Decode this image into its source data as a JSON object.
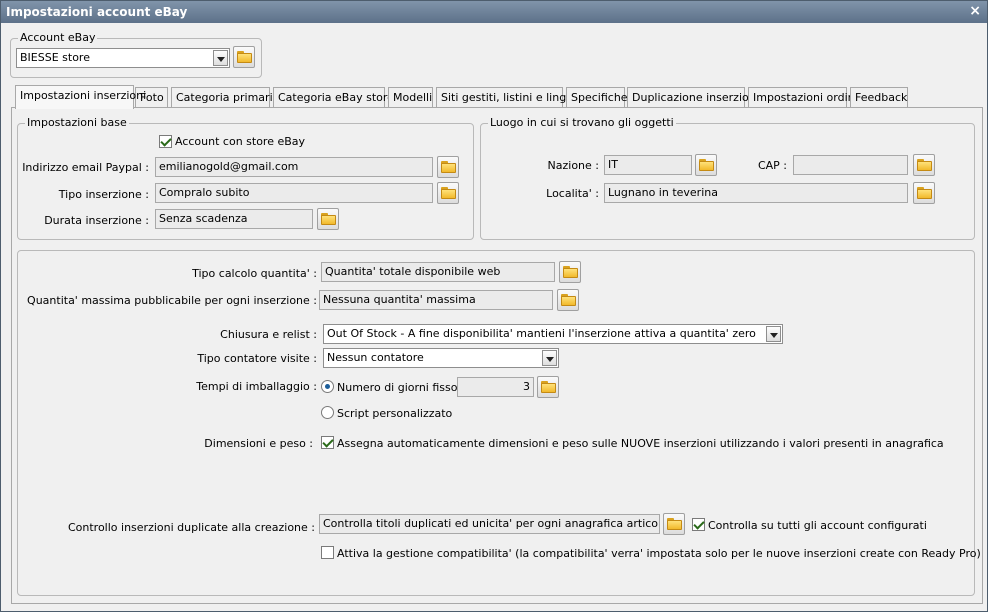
{
  "window": {
    "title": "Impostazioni account eBay",
    "close_label": "×"
  },
  "account": {
    "legend": "Account eBay",
    "selected": "BIESSE store"
  },
  "tabs": [
    "Impostazioni inserzioni",
    "Foto",
    "Categoria primaria",
    "Categoria eBay store",
    "Modelli",
    "Siti gestiti, listini e lingue",
    "Specifiche",
    "Duplicazione inserzioni",
    "Impostazioni ordini",
    "Feedback"
  ],
  "base": {
    "legend": "Impostazioni base",
    "store_checkbox": "Account con store eBay",
    "email_label": "Indirizzo email Paypal :",
    "email_value": "emilianogold@gmail.com",
    "tipo_label": "Tipo inserzione :",
    "tipo_value": "Compralo subito",
    "durata_label": "Durata inserzione :",
    "durata_value": "Senza scadenza"
  },
  "location": {
    "legend": "Luogo in cui si trovano gli oggetti",
    "nazione_label": "Nazione :",
    "nazione_value": "IT",
    "cap_label": "CAP :",
    "cap_value": "",
    "localita_label": "Localita' :",
    "localita_value": "Lugnano in teverina"
  },
  "settings": {
    "calcolo_label": "Tipo calcolo quantita' :",
    "calcolo_value": "Quantita' totale disponibile web",
    "massima_label": "Quantita' massima pubblicabile per ogni inserzione :",
    "massima_value": "Nessuna quantita' massima",
    "chiusura_label": "Chiusura e relist :",
    "chiusura_value": "Out Of Stock - A fine disponibilita' mantieni l'inserzione attiva a quantita' zero",
    "contatore_label": "Tipo contatore visite :",
    "contatore_value": "Nessun contatore",
    "imballaggio_label": "Tempi di imballaggio :",
    "radio_fisso": "Numero di giorni fisso",
    "giorni_value": "3",
    "radio_script": "Script personalizzato",
    "dimensioni_label": "Dimensioni e peso :",
    "dimensioni_check": "Assegna automaticamente dimensioni e peso sulle NUOVE inserzioni utilizzando i valori presenti in anagrafica",
    "duplicate_label": "Controllo inserzioni duplicate alla creazione :",
    "duplicate_value": "Controlla titoli duplicati ed unicita' per ogni anagrafica articolo",
    "controlla_tutti": "Controlla su tutti gli account configurati",
    "compat_check": "Attiva la gestione compatibilita'  (la compatibilita' verra' impostata solo per le nuove inserzioni create con Ready Pro)"
  }
}
